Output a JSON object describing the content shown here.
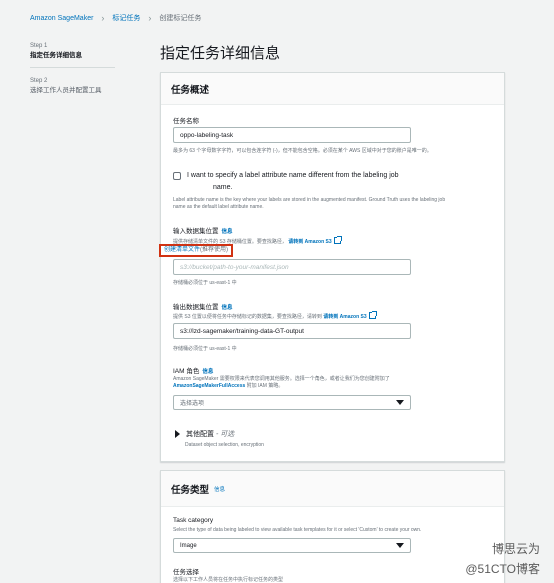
{
  "breadcrumb": {
    "root": "Amazon SageMaker",
    "jobs": "标记任务",
    "current": "创建标记任务"
  },
  "steps": [
    {
      "num": "Step 1",
      "label": "指定任务详细信息"
    },
    {
      "num": "Step 2",
      "label": "选择工作人员并配置工具"
    }
  ],
  "page_title": "指定任务详细信息",
  "overview": {
    "title": "任务概述",
    "name_label": "任务名称",
    "name_value": "oppo-labeling-task",
    "name_desc": "最多为 63 个字母数字字符，可以包含连字符 (-)，但不能包含空格。必须在某个 AWS 区域中对于您的账户是唯一的。",
    "checkbox_line1": "I want to specify a label attribute name different from the labeling job",
    "checkbox_line2": "name.",
    "checkbox_desc1": "Label attribute name is the key where your labels are stored in the augmented manifest. Ground Truth uses the labeling job",
    "checkbox_desc2": "name as the default label attribute name.",
    "input_label": "输入数据集位置",
    "input_desc": "提供存储清单文件的 S3 存储桶位置。要查找路径，",
    "input_link": "请转到 Amazon S3",
    "manifest_link": "创建清单文件",
    "manifest_note": "(推荐使用)",
    "input_placeholder": "s3://bucket/path-to-your-manifest.json",
    "input_hint": "存储桶必须位于 us-east-1 中",
    "output_label": "输出数据集位置",
    "output_desc": "提供 S3 位置以便将任务中存储标记的数据集，要查找路径，请转到",
    "output_link": "请转到 Amazon S3",
    "output_value": "s3://lzd-sagemaker/training-data-GT-output",
    "output_hint": "存储桶必须位于 us-east-1 中",
    "iam_label": "IAM 角色",
    "iam_desc1": "Amazon SageMaker 需要权限来代表您调用其他服务。选择一个角色，或者让我们为您创建附加了",
    "iam_desc2_link": "AmazonSageMakerFullAccess",
    "iam_desc2_rest": "附加 IAM 策略。",
    "iam_select": "选择选项",
    "other_label": "其他配置",
    "other_optional": "- 可选",
    "other_desc": "Dataset object selection, encryption",
    "info": "信息"
  },
  "task_type": {
    "title": "任务类型",
    "info": "信息",
    "category_label": "Task category",
    "category_desc": "Select the type of data being labeled to view available task templates for it or select 'Custom' to create your own.",
    "category_value": "Image",
    "select_label": "任务选择",
    "select_desc": "选择以下工作人员将在任务中执行标记任务的类型"
  },
  "watermarks": {
    "line1": "博思云为",
    "line2": "@51CTO博客"
  }
}
